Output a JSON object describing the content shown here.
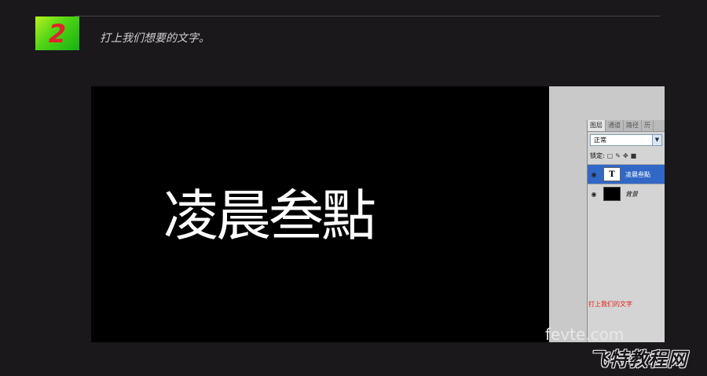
{
  "step": {
    "number": "2",
    "title": "打上我们想要的文字。"
  },
  "canvas": {
    "text": "凌晨叁點"
  },
  "layers_panel": {
    "tabs": [
      {
        "label": "图层"
      },
      {
        "label": "通道"
      },
      {
        "label": "路径"
      },
      {
        "label": "历"
      }
    ],
    "blend_mode": "正常",
    "lock_label": "锁定:",
    "layers": [
      {
        "name": "凌晨叁點",
        "thumb": "T",
        "selected": true
      },
      {
        "name": "背景",
        "thumb": "",
        "selected": false
      }
    ],
    "note": "打上我们的文字"
  },
  "watermark": {
    "site": "fevte.com",
    "name": "飞特教程网"
  },
  "colors": {
    "badge_green": "#4fd414",
    "step_number": "#e0232a",
    "selection": "#3168c6",
    "note": "#e0221c"
  }
}
